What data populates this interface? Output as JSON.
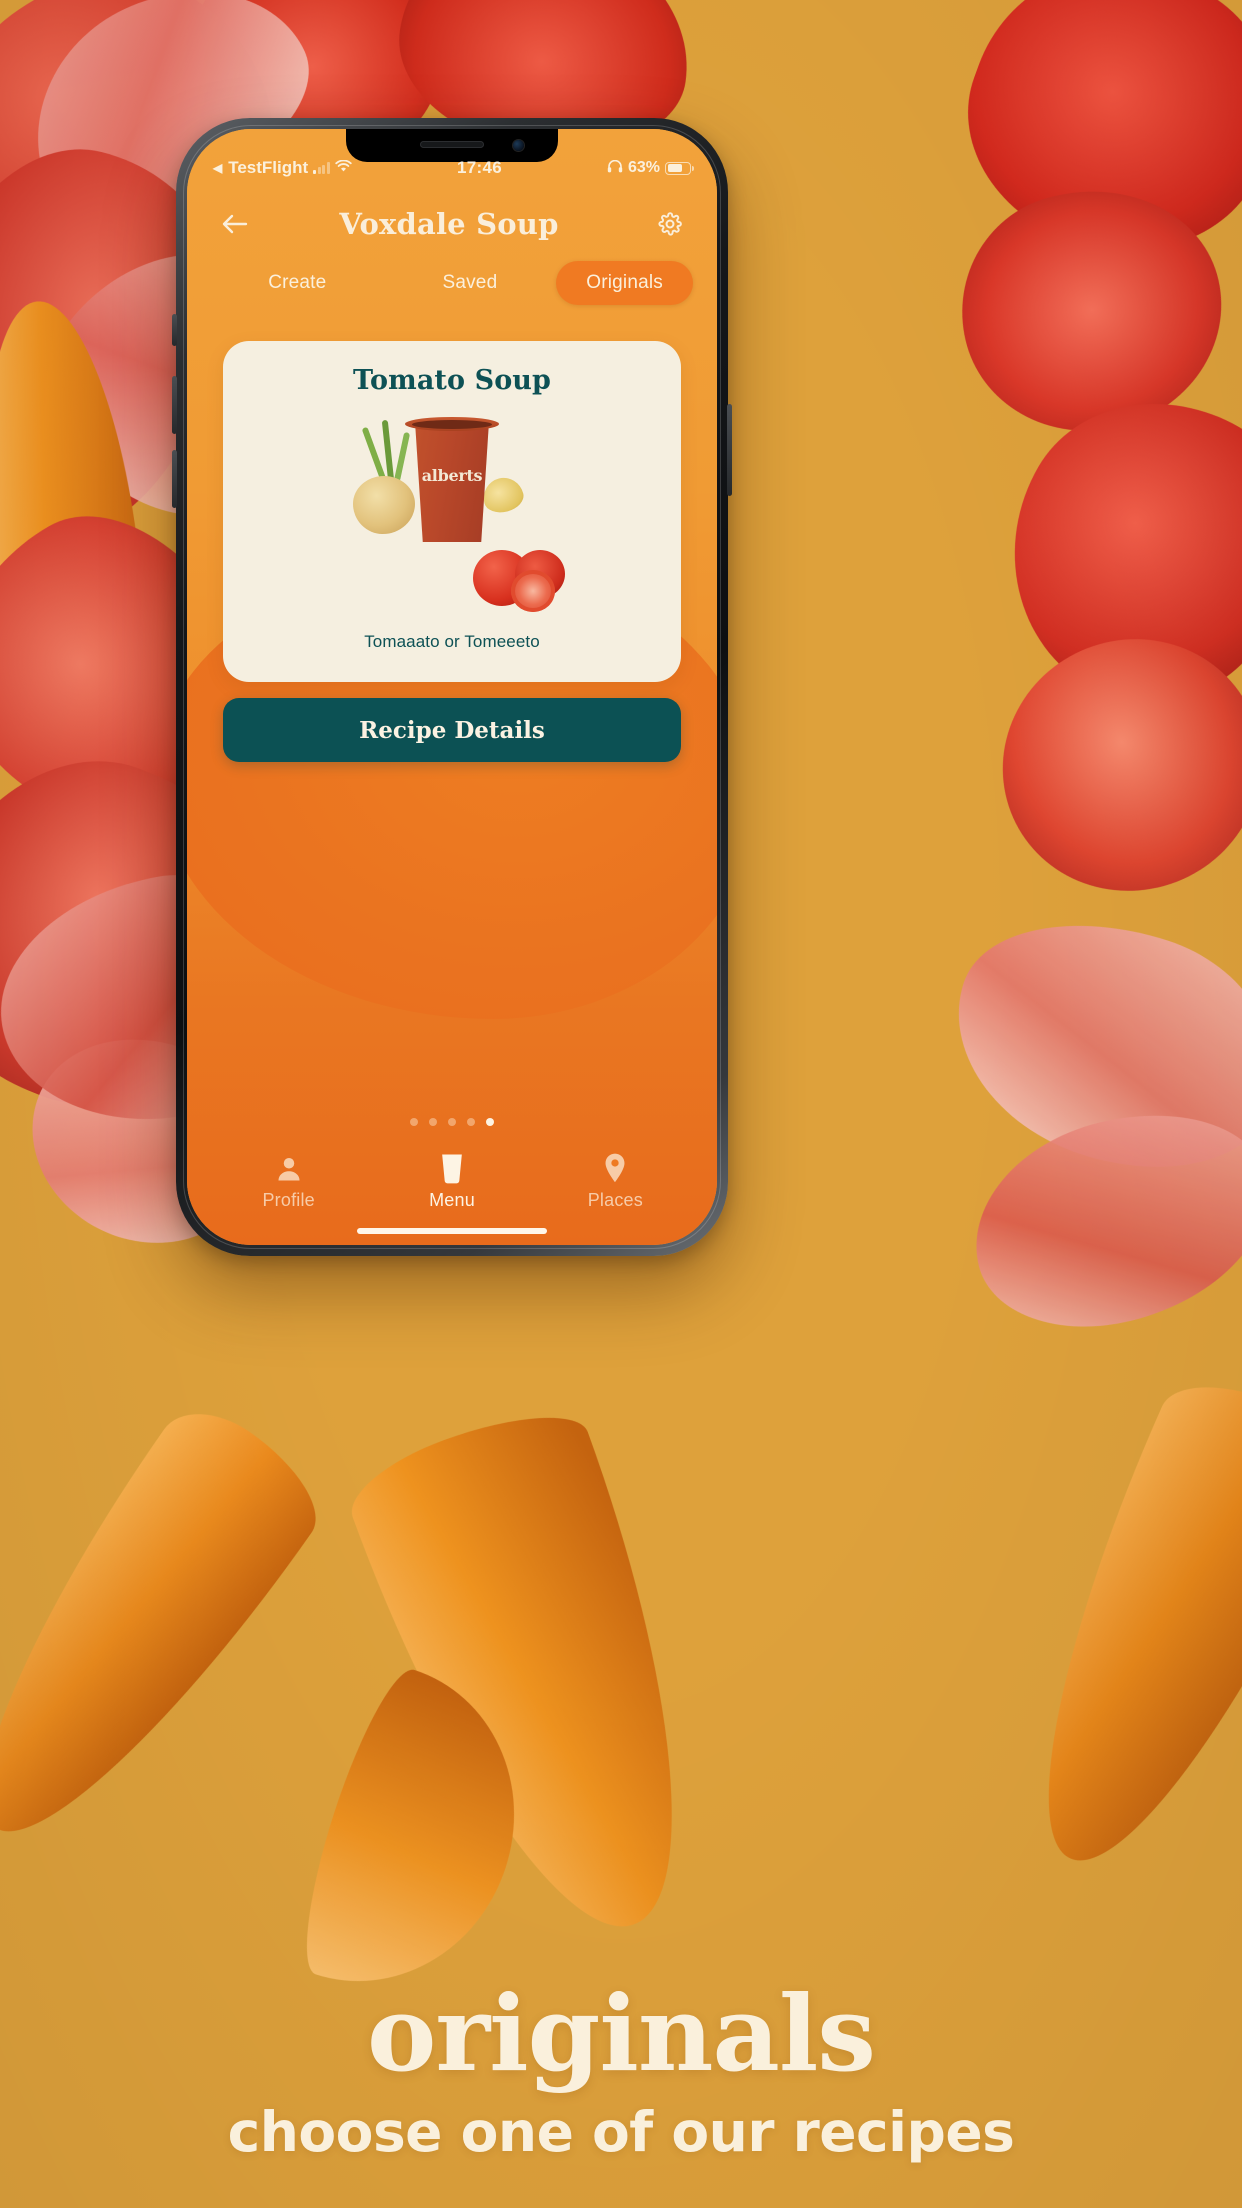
{
  "status_bar": {
    "back_app": "TestFlight",
    "back_arrow": "◀",
    "signal_icon": "cellular-bars-icon",
    "wifi_icon": "wifi-icon",
    "time": "17:46",
    "headphones_icon": "headphones-icon",
    "battery_percent": "63%",
    "battery_icon": "battery-icon"
  },
  "header": {
    "back_icon": "arrow-left-icon",
    "title": "Voxdale Soup",
    "settings_icon": "gear-icon"
  },
  "tabs": [
    {
      "label": "Create",
      "active": false
    },
    {
      "label": "Saved",
      "active": false
    },
    {
      "label": "Originals",
      "active": true
    }
  ],
  "card": {
    "title": "Tomato Soup",
    "image_alt": "alberts-soup-cup-with-tomatoes-onion-scallion",
    "cup_brand": "alberts",
    "subtitle": "Tomaaato or Tomeeeto"
  },
  "cta": {
    "label": "Recipe Details"
  },
  "pagination": {
    "total": 5,
    "active_index": 4
  },
  "bottom_nav": [
    {
      "label": "Profile",
      "icon": "person-icon",
      "active": false
    },
    {
      "label": "Menu",
      "icon": "cup-icon",
      "active": true
    },
    {
      "label": "Places",
      "icon": "map-pin-icon",
      "active": false
    }
  ],
  "caption": {
    "headline": "originals",
    "subline": "choose one of our recipes"
  },
  "colors": {
    "background": "#DEA13B",
    "app_orange_top": "#F2A23B",
    "app_orange_bottom": "#E86B1C",
    "accent_pill": "#F07A22",
    "card_bg": "#F5EFE0",
    "teal": "#0C5154",
    "cream_text": "#FAEEDA"
  }
}
